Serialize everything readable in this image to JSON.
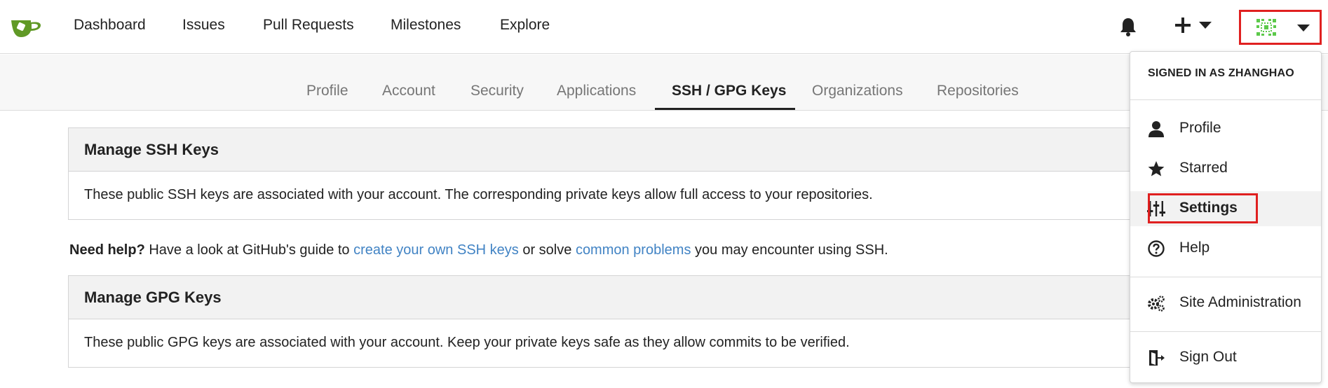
{
  "navbar": {
    "items": [
      "Dashboard",
      "Issues",
      "Pull Requests",
      "Milestones",
      "Explore"
    ],
    "logo_color": "#609926",
    "avatar_color": "#5cc94a",
    "highlight_color": "#e02020"
  },
  "tabs": {
    "items": [
      "Profile",
      "Account",
      "Security",
      "Applications",
      "SSH / GPG Keys",
      "Organizations",
      "Repositories"
    ],
    "active": "SSH / GPG Keys"
  },
  "ssh": {
    "title": "Manage SSH Keys",
    "description": "These public SSH keys are associated with your account. The corresponding private keys allow full access to your repositories."
  },
  "help": {
    "bold": "Need help?",
    "text1": " Have a look at GitHub's guide to ",
    "link1": "create your own SSH keys",
    "text2": " or solve ",
    "link2": "common problems",
    "text3": " you may encounter using SSH."
  },
  "gpg": {
    "title": "Manage GPG Keys",
    "description": "These public GPG keys are associated with your account. Keep your private keys safe as they allow commits to be verified."
  },
  "dropdown": {
    "header": "SIGNED IN AS ZHANGHAO",
    "items": [
      {
        "label": "Profile",
        "icon": "person-icon"
      },
      {
        "label": "Starred",
        "icon": "star-icon"
      },
      {
        "label": "Settings",
        "icon": "settings-sliders-icon"
      },
      {
        "label": "Help",
        "icon": "help-circle-icon"
      },
      {
        "label": "Site Administration",
        "icon": "gears-icon"
      },
      {
        "label": "Sign Out",
        "icon": "sign-out-icon"
      }
    ]
  }
}
